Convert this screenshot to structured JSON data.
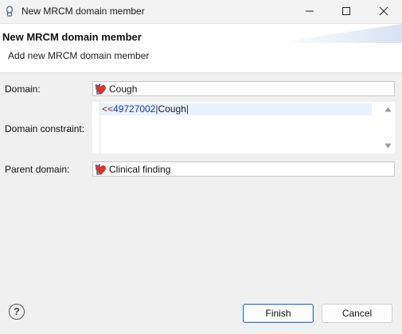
{
  "window": {
    "title": "New MRCM domain member",
    "icons": {
      "app": "app-icon",
      "minimize": "minimize-icon",
      "maximize": "maximize-icon",
      "close": "close-icon"
    }
  },
  "banner": {
    "title": "New MRCM domain member",
    "subtitle": "Add new MRCM domain member"
  },
  "form": {
    "domain": {
      "label": "Domain:",
      "value": "Cough",
      "icon": "clinical-finding-icon"
    },
    "constraint": {
      "label": "Domain constraint:",
      "operator": "<<",
      "concept_id": "49727002",
      "separator": "|",
      "term": "Cough",
      "separator_end": "|"
    },
    "parent": {
      "label": "Parent domain:",
      "value": "Clinical finding",
      "icon": "clinical-finding-icon"
    }
  },
  "footer": {
    "help": "?",
    "finish_label": "Finish",
    "cancel_label": "Cancel"
  },
  "colors": {
    "primary_border": "#2a6fd1",
    "constraint_highlight": "#e8f2fe"
  }
}
